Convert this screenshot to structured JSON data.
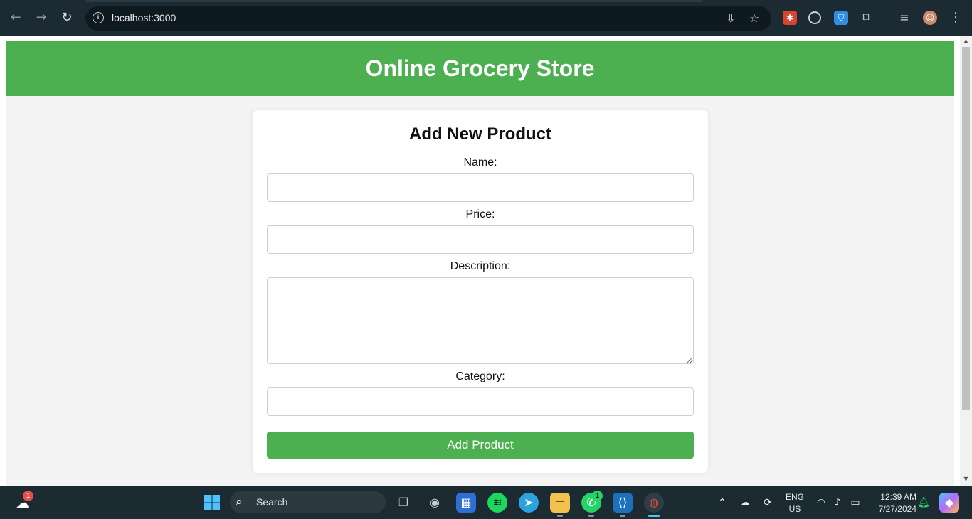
{
  "browser": {
    "url": "localhost:3000",
    "back_icon": "←",
    "forward_icon": "→",
    "reload_icon": "↻",
    "info_icon": "i",
    "install_icon": "⇩",
    "star_icon": "☆",
    "extensions_icon": "⧉",
    "menu_icon": "⋮",
    "media_icon": "≡"
  },
  "site": {
    "header_title": "Online Grocery Store",
    "accent_color": "#4caf50"
  },
  "form": {
    "title": "Add New Product",
    "name_label": "Name:",
    "price_label": "Price:",
    "description_label": "Description:",
    "category_label": "Category:",
    "submit_label": "Add Product",
    "name_value": "",
    "price_value": "",
    "description_value": "",
    "category_value": ""
  },
  "taskbar": {
    "search_label": "Search",
    "weather_badge": "1",
    "whatsapp_badge": "1",
    "language": "ENG",
    "region": "US",
    "time": "12:39 AM",
    "date": "7/27/2024"
  }
}
